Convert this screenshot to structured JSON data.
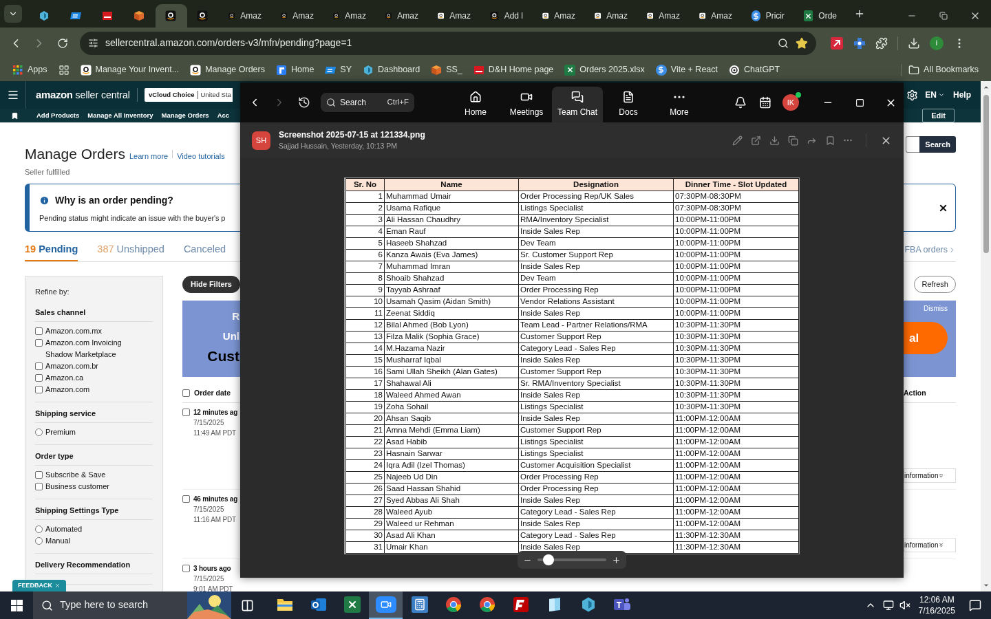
{
  "browser": {
    "tabs": [
      {
        "kind": "hex",
        "selected": false
      },
      {
        "kind": "ec",
        "selected": false
      },
      {
        "kind": "dh",
        "selected": false
      },
      {
        "kind": "box",
        "selected": false
      },
      {
        "kind": "amazon",
        "selected": true
      },
      {
        "kind": "amazon",
        "selected": false
      },
      {
        "title": "Amaz",
        "kind": "amazon",
        "selected": false
      },
      {
        "title": "Amaz",
        "kind": "amazon",
        "selected": false
      },
      {
        "title": "Amaz",
        "kind": "amazon",
        "selected": false
      },
      {
        "title": "Amaz",
        "kind": "amazon",
        "selected": false
      },
      {
        "title": "Amaz",
        "kind": "amazon_light",
        "selected": false
      },
      {
        "title": "Add l",
        "kind": "amazon",
        "selected": false
      },
      {
        "title": "Amaz",
        "kind": "amazon_light",
        "selected": false
      },
      {
        "title": "Amaz",
        "kind": "amazon_light",
        "selected": false
      },
      {
        "title": "Amaz",
        "kind": "amazon_light",
        "selected": false
      },
      {
        "title": "Amaz",
        "kind": "amazon_light",
        "selected": false
      },
      {
        "title": "Pricir",
        "kind": "dollar",
        "selected": false
      },
      {
        "title": "Orde",
        "kind": "excel",
        "selected": false
      }
    ],
    "address": "sellercentral.amazon.com/orders-v3/mfn/pending?page=1",
    "profile_initial": "i",
    "bookmarks": [
      {
        "label": "Apps",
        "kind": "apps"
      },
      {
        "kind": "grid"
      },
      {
        "label": "Manage Your Invent...",
        "kind": "amazon_light"
      },
      {
        "label": "Manage Orders",
        "kind": "amazon_light"
      },
      {
        "label": "Home",
        "kind": "home"
      },
      {
        "label": "SY",
        "kind": "ec"
      },
      {
        "label": "Dashboard",
        "kind": "hex"
      },
      {
        "label": "SS_",
        "kind": "box"
      },
      {
        "label": "D&H Home page",
        "kind": "dh"
      },
      {
        "label": "Orders 2025.xlsx",
        "kind": "excel"
      },
      {
        "label": "Vite + React",
        "kind": "dollar"
      },
      {
        "label": "ChatGPT",
        "kind": "chatgpt"
      }
    ],
    "all_bookmarks": "All Bookmarks"
  },
  "seller_central": {
    "logo": {
      "word": "amazon",
      "suffix": "seller central"
    },
    "account": {
      "store": "vCloud Choice",
      "marketplace": "United Sta"
    },
    "language": "EN",
    "help": "Help",
    "nav": [
      "Add Products",
      "Manage All Inventory",
      "Manage Orders",
      "Acc"
    ],
    "edit": "Edit",
    "title": "Manage Orders",
    "links": [
      "Learn more",
      "Video tutorials"
    ],
    "subtitle": "Seller fulfilled",
    "search_button": "Search",
    "notice": {
      "title": "Why is an order pending?",
      "text": "Pending status might indicate an issue with the buyer's p"
    },
    "order_tabs": [
      {
        "count": "19",
        "label": "Pending",
        "selected": true
      },
      {
        "count": "387",
        "label": "Unshipped",
        "selected": false
      },
      {
        "label": "Canceled",
        "selected": false
      }
    ],
    "fba_link": "FBA orders",
    "filters": {
      "title": "Refine by:",
      "groups": [
        {
          "title": "Sales channel",
          "options": [
            {
              "label": "Amazon.com.mx",
              "kind": "checkbox",
              "checked": false
            },
            {
              "label": "Amazon.com Invoicing Shadow Marketplace",
              "kind": "checkbox",
              "checked": false
            },
            {
              "label": "Amazon.com.br",
              "kind": "checkbox",
              "checked": false
            },
            {
              "label": "Amazon.ca",
              "kind": "checkbox",
              "checked": false
            },
            {
              "label": "Amazon.com",
              "kind": "checkbox",
              "checked": false
            }
          ]
        },
        {
          "title": "Shipping service",
          "options": [
            {
              "label": "Premium",
              "kind": "radio",
              "checked": false
            }
          ]
        },
        {
          "title": "Order type",
          "options": [
            {
              "label": "Subscribe & Save",
              "kind": "checkbox",
              "checked": false
            },
            {
              "label": "Business customer",
              "kind": "checkbox",
              "checked": false
            }
          ]
        },
        {
          "title": "Shipping Settings Type",
          "options": [
            {
              "label": "Automated",
              "kind": "radio",
              "checked": false
            },
            {
              "label": "Manual",
              "kind": "radio",
              "checked": false
            }
          ]
        },
        {
          "title": "Delivery Recommendation"
        }
      ]
    },
    "hide_filters": "Hide Filters",
    "refresh": "Refresh",
    "banner": {
      "lines": [
        "R",
        "Unl",
        "Cust"
      ],
      "dismiss": "Dismiss",
      "cta": "al"
    },
    "columns": {
      "date": "Order date",
      "action": "Action",
      "all_checked": false
    },
    "orders": [
      {
        "age": "12 minutes ag",
        "date": "7/15/2025",
        "time": "11:49 AM PDT",
        "checked": false,
        "action": "information"
      },
      {
        "age": "46 minutes ag",
        "date": "7/15/2025",
        "time": "11:16 AM PDT",
        "checked": false,
        "action": "information"
      },
      {
        "age": "3 hours ago",
        "date": "7/15/2025",
        "time": "9:01 AM PDT",
        "checked": false
      }
    ],
    "feedback": "FEEDBACK"
  },
  "chat_viewer": {
    "search": {
      "placeholder": "Search",
      "shortcut": "Ctrl+F"
    },
    "nav": [
      {
        "label": "Home",
        "kind": "home",
        "selected": false
      },
      {
        "label": "Meetings",
        "kind": "video",
        "selected": false
      },
      {
        "label": "Team Chat",
        "kind": "chat",
        "selected": true
      },
      {
        "label": "Docs",
        "kind": "doc",
        "selected": false
      },
      {
        "label": "More",
        "kind": "more",
        "selected": false
      }
    ],
    "user_initials": "IK",
    "online": true,
    "file": {
      "sender_initials": "SH",
      "name": "Screenshot 2025-07-15 at 121334.png",
      "meta": "Sajjad Hussain, Yesterday, 10:13 PM"
    },
    "zoom": {
      "level": 0.1
    },
    "sheet": {
      "columns": [
        "Sr. No",
        "Name",
        "Designation",
        "Dinner Time - Slot Updated"
      ],
      "rows": [
        [
          "1",
          "Muhammad Umair",
          "Order Processing Rep/UK Sales",
          "07:30PM-08:30PM"
        ],
        [
          "2",
          "Usama Rafique",
          "Listings Specialist",
          "07:30PM-08:30PM"
        ],
        [
          "3",
          "Ali Hassan Chaudhry",
          "RMA/Inventory Specialist",
          "10:00PM-11:00PM"
        ],
        [
          "4",
          "Eman Rauf",
          "Inside Sales Rep",
          "10:00PM-11:00PM"
        ],
        [
          "5",
          "Haseeb Shahzad",
          "Dev Team",
          "10:00PM-11:00PM"
        ],
        [
          "6",
          "Kanza Awais (Eva James)",
          "Sr. Customer Support Rep",
          "10:00PM-11:00PM"
        ],
        [
          "7",
          "Muhammad Imran",
          "Inside Sales Rep",
          "10:00PM-11:00PM"
        ],
        [
          "8",
          "Shoaib Shahzad",
          "Dev Team",
          "10:00PM-11:00PM"
        ],
        [
          "9",
          "Tayyab Ashraaf",
          "Order Processing Rep",
          "10:00PM-11:00PM"
        ],
        [
          "10",
          "Usamah Qasim (Aidan Smith)",
          "Vendor Relations Assistant",
          "10:00PM-11:00PM"
        ],
        [
          "11",
          "Zeenat Siddiq",
          "Inside Sales Rep",
          "10:00PM-11:00PM"
        ],
        [
          "12",
          "Bilal Ahmed (Bob Lyon)",
          "Team Lead - Partner Relations/RMA",
          "10:30PM-11:30PM"
        ],
        [
          "13",
          "Filza Malik (Sophia Grace)",
          "Customer Support Rep",
          "10:30PM-11:30PM"
        ],
        [
          "14",
          "M.Hazama Nazir",
          "Category Lead - Sales Rep",
          "10:30PM-11:30PM"
        ],
        [
          "15",
          "Musharraf Iqbal",
          "Inside Sales Rep",
          "10:30PM-11:30PM"
        ],
        [
          "16",
          "Sami Ullah Sheikh (Alan Gates)",
          "Customer Support Rep",
          "10:30PM-11:30PM"
        ],
        [
          "17",
          "Shahawal Ali",
          "Sr. RMA/Inventory Specialist",
          "10:30PM-11:30PM"
        ],
        [
          "18",
          "Waleed Ahmed Awan",
          "Inside Sales Rep",
          "10:30PM-11:30PM"
        ],
        [
          "19",
          "Zoha Sohail",
          "Listings Specialist",
          "10:30PM-11:30PM"
        ],
        [
          "20",
          "Ahsan Saqib",
          "Inside Sales Rep",
          "11:00PM-12:00AM"
        ],
        [
          "21",
          "Amna Mehdi (Emma Liam)",
          "Customer Support Rep",
          "11:00PM-12:00AM"
        ],
        [
          "22",
          "Asad Habib",
          "Listings Specialist",
          "11:00PM-12:00AM"
        ],
        [
          "23",
          "Hasnain Sarwar",
          "Listings Specialist",
          "11:00PM-12:00AM"
        ],
        [
          "24",
          "Iqra Adil (Izel Thomas)",
          "Customer Acquisition Specialist",
          "11:00PM-12:00AM"
        ],
        [
          "25",
          "Najeeb Ud Din",
          "Order Processing Rep",
          "11:00PM-12:00AM"
        ],
        [
          "26",
          "Saad Hassan Shahid",
          "Order Processing Rep",
          "11:00PM-12:00AM"
        ],
        [
          "27",
          "Syed Abbas Ali Shah",
          "Inside Sales Rep",
          "11:00PM-12:00AM"
        ],
        [
          "28",
          "Waleed Ayub",
          "Category Lead - Sales Rep",
          "11:00PM-12:00AM"
        ],
        [
          "29",
          "Waleed ur Rehman",
          "Inside Sales Rep",
          "11:00PM-12:00AM"
        ],
        [
          "30",
          "Asad Ali Khan",
          "Category Lead - Sales Rep",
          "11:30PM-12:30AM"
        ],
        [
          "31",
          "Umair Khan",
          "Inside Sales Rep",
          "11:30PM-12:30AM"
        ]
      ]
    }
  },
  "taskbar": {
    "search_placeholder": "Type here to search",
    "apps": [
      {
        "kind": "explorer",
        "selected": false
      },
      {
        "kind": "outlook",
        "selected": false
      },
      {
        "kind": "excel",
        "selected": false
      },
      {
        "kind": "zoom",
        "selected": true
      },
      {
        "kind": "calculator",
        "selected": false
      },
      {
        "kind": "chrome",
        "selected": false
      },
      {
        "kind": "chrome",
        "selected": false
      },
      {
        "kind": "filezilla",
        "selected": false
      },
      {
        "kind": "notes",
        "selected": false
      },
      {
        "kind": "hex",
        "selected": false
      },
      {
        "kind": "teams",
        "selected": false
      }
    ],
    "time": "12:06 AM",
    "date": "7/16/2025"
  }
}
